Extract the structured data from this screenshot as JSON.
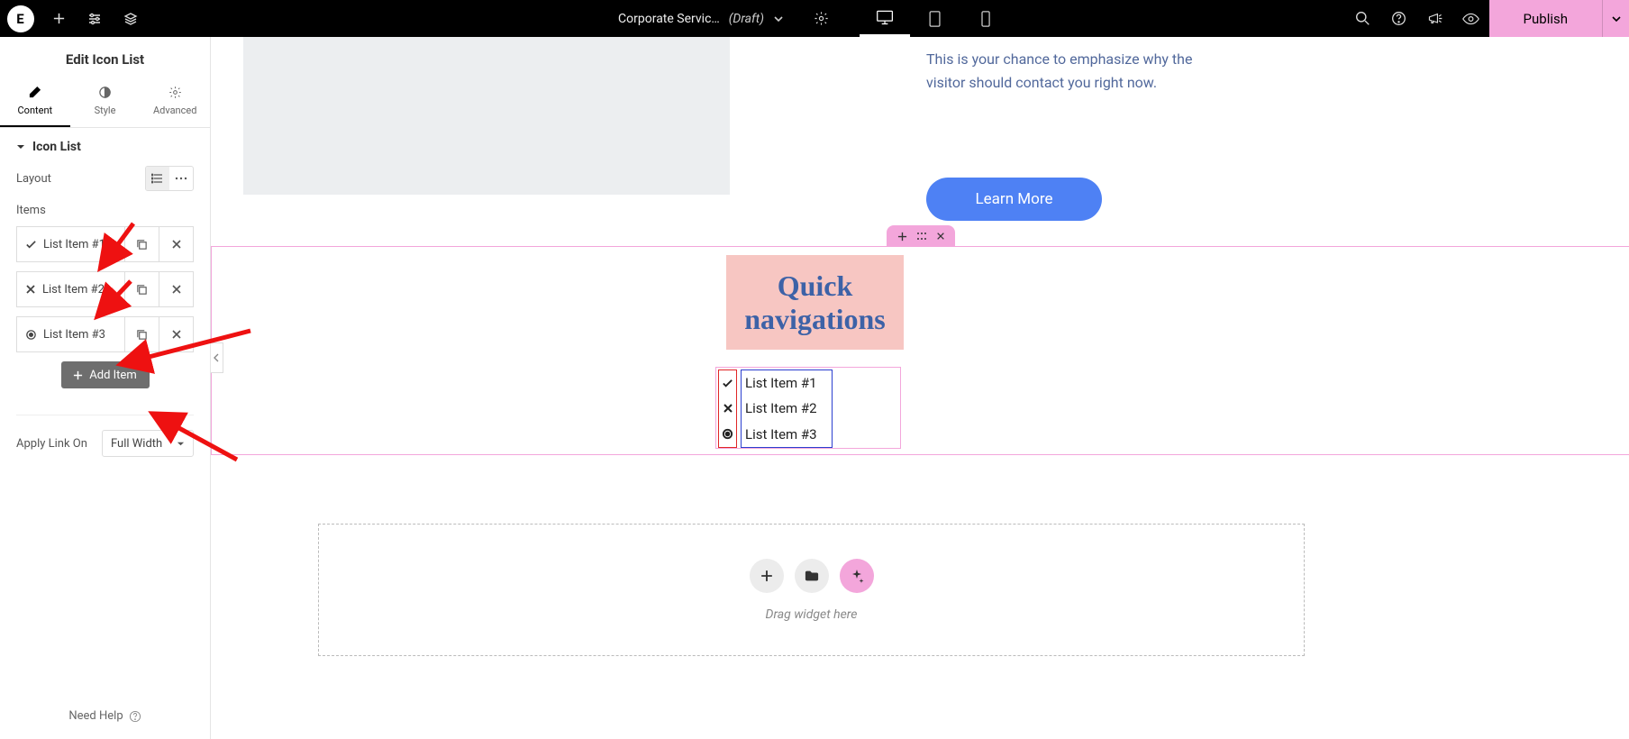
{
  "topbar": {
    "logo_letter": "E",
    "doc_title": "Corporate Servic…",
    "doc_status": "(Draft)",
    "publish_label": "Publish"
  },
  "panel": {
    "title": "Edit Icon List",
    "tabs": {
      "content": "Content",
      "style": "Style",
      "advanced": "Advanced"
    },
    "section_title": "Icon List",
    "layout_label": "Layout",
    "items_label": "Items",
    "items": [
      {
        "label": "List Item #1",
        "icon": "check"
      },
      {
        "label": "List Item #2",
        "icon": "times"
      },
      {
        "label": "List Item #3",
        "icon": "dot"
      }
    ],
    "add_item_label": "Add Item",
    "apply_link_label": "Apply Link On",
    "apply_link_value": "Full Width",
    "need_help": "Need Help"
  },
  "canvas": {
    "cta_text": "This is your chance to emphasize why the visitor should contact you right now.",
    "learn_label": "Learn More",
    "quick_heading": "Quick navigations",
    "icon_list": [
      {
        "icon": "check",
        "text": "List Item #1"
      },
      {
        "icon": "times",
        "text": "List Item #2"
      },
      {
        "icon": "dot",
        "text": "List Item #3"
      }
    ],
    "drop_hint": "Drag widget here"
  }
}
